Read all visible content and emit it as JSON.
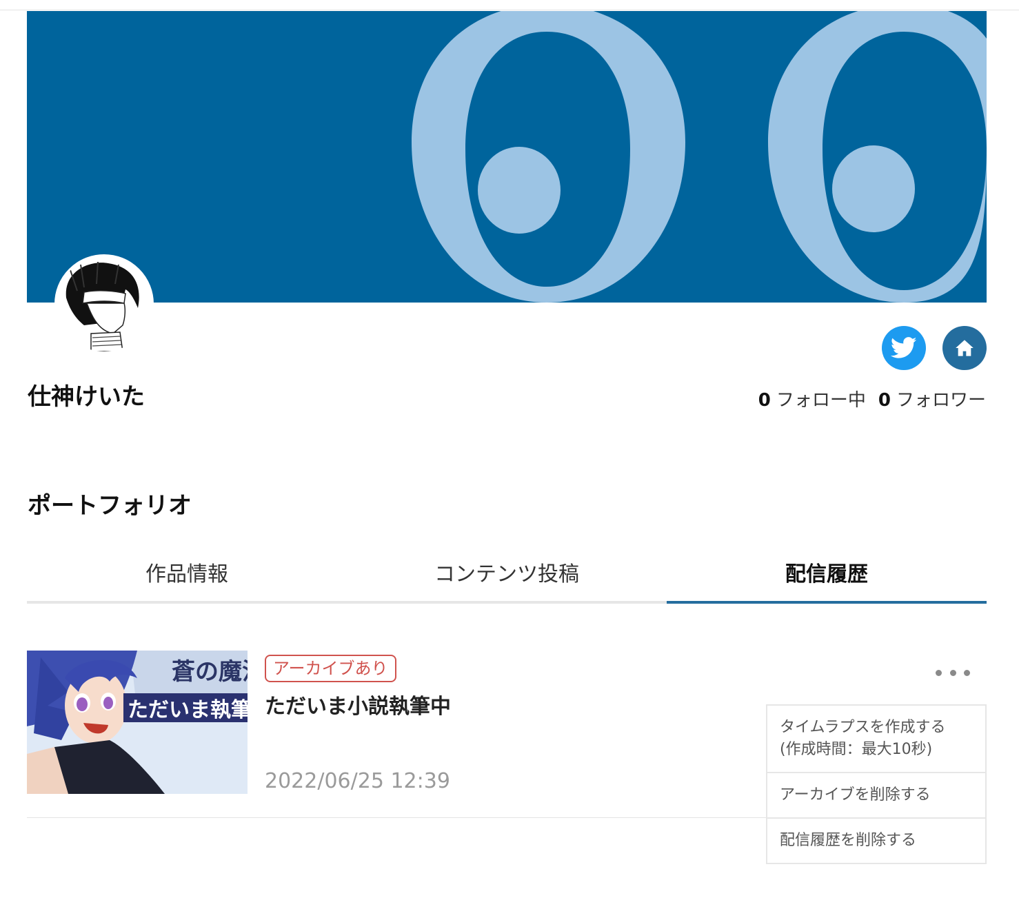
{
  "profile": {
    "name": "仕神けいた",
    "following_count": "0",
    "following_label": "フォロー中",
    "follower_count": "0",
    "follower_label": "フォロワー"
  },
  "social": {
    "twitter_icon": "twitter-bird-icon",
    "home_icon": "home-icon"
  },
  "colors": {
    "banner_bg": "#00649c",
    "banner_glyph": "#9cc4e4",
    "accent": "#246d9e",
    "badge": "#d0524d"
  },
  "portfolio": {
    "title": "ポートフォリオ",
    "tabs": [
      {
        "label": "作品情報",
        "active": false
      },
      {
        "label": "コンテンツ投稿",
        "active": false
      },
      {
        "label": "配信履歴",
        "active": true
      }
    ]
  },
  "stream": {
    "badge": "アーカイブあり",
    "title": "ただいま小説執筆中",
    "date": "2022/06/25 12:39",
    "thumb_text_top": "蒼の魔法",
    "thumb_text_bottom": "ただいま執筆"
  },
  "menu": {
    "timelapse_line1": "タイムラプスを作成する",
    "timelapse_line2": "(作成時間：最大10秒)",
    "delete_archive": "アーカイブを削除する",
    "delete_history": "配信履歴を削除する"
  }
}
